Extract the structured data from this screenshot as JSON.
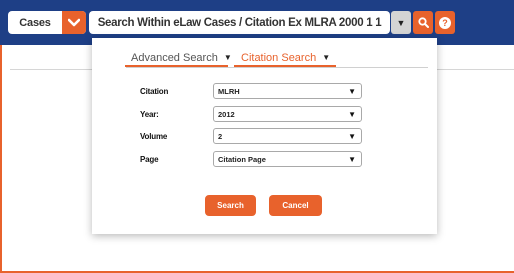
{
  "header": {
    "scope_label": "Cases",
    "search_text": "Search Within eLaw Cases / Citation Ex MLRA 2000 1 1",
    "dropdown_icon": "caret-down-icon",
    "search_icon": "magnifier-icon",
    "help_icon": "question-mark-icon",
    "help_glyph": "?"
  },
  "tabs": [
    {
      "label": "Advanced Search",
      "active": false
    },
    {
      "label": "Citation Search",
      "active": true
    }
  ],
  "form": {
    "fields": [
      {
        "label": "Citation",
        "value": "MLRH"
      },
      {
        "label": "Year:",
        "value": "2012"
      },
      {
        "label": "Volume",
        "value": "2"
      },
      {
        "label": "Page",
        "value": "Citation Page"
      }
    ]
  },
  "actions": {
    "search_label": "Search",
    "cancel_label": "Cancel"
  },
  "colors": {
    "brand_blue": "#1e3f86",
    "accent_orange": "#e8622c"
  }
}
